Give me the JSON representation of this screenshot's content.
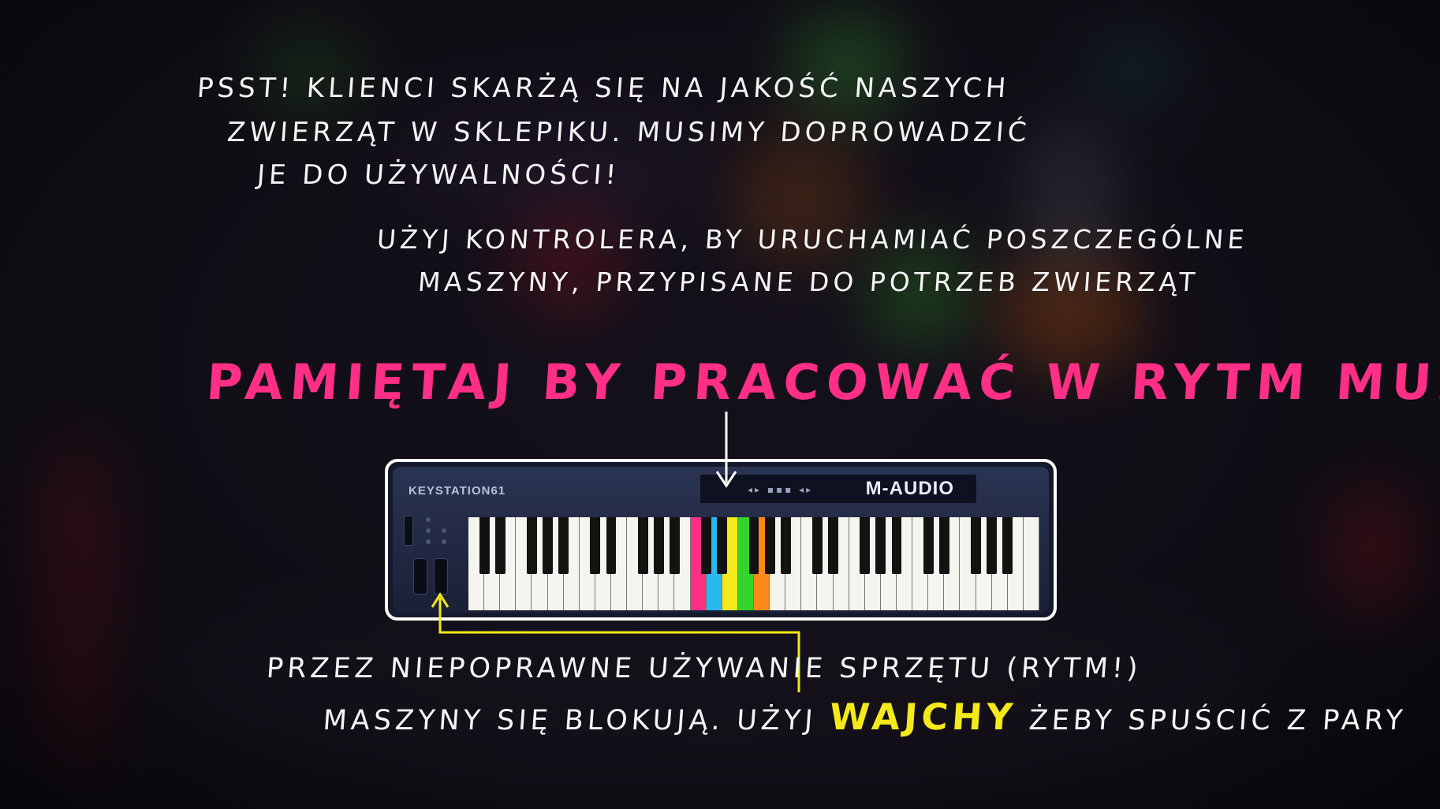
{
  "intro": {
    "line1": "PSST! KLIENCI SKARŻĄ SIĘ NA JAKOŚĆ NASZYCH",
    "line2": "ZWIERZĄT W SKLEPIKU. MUSIMY DOPROWADZIĆ",
    "line3": "JE DO UŻYWALNOŚCI!"
  },
  "instruction": {
    "line1": "UŻYJ KONTROLERA, BY URUCHAMIAĆ POSZCZEGÓLNE",
    "line2": "MASZYNY, PRZYPISANE DO POTRZEB ZWIERZĄT"
  },
  "headline": "PAMIĘTAJ BY PRACOWAĆ W RYTM MUZYKI!",
  "keyboard": {
    "model": "KEYSTATION61",
    "brand": "M-AUDIO",
    "white_key_count": 36,
    "highlighted_keys": [
      {
        "index": 14,
        "color": "#ff2f86"
      },
      {
        "index": 15,
        "color": "#29b8ef"
      },
      {
        "index": 16,
        "color": "#f4e91a"
      },
      {
        "index": 17,
        "color": "#35d42c"
      },
      {
        "index": 18,
        "color": "#ff8a1c"
      }
    ]
  },
  "warning": {
    "line1": "PRZEZ NIEPOPRAWNE UŻYWANIE SPRZĘTU (RYTM!)",
    "line2_start": "MASZYNY SIĘ BLOKUJĄ. UŻYJ",
    "line2_highlight": "WAJCHY",
    "line2_end": "ŻEBY SPUŚCIĆ Z PARY"
  },
  "colors": {
    "accent_pink": "#ff2f86",
    "accent_yellow": "#f4e91a",
    "text_white": "#f4f4f4"
  }
}
